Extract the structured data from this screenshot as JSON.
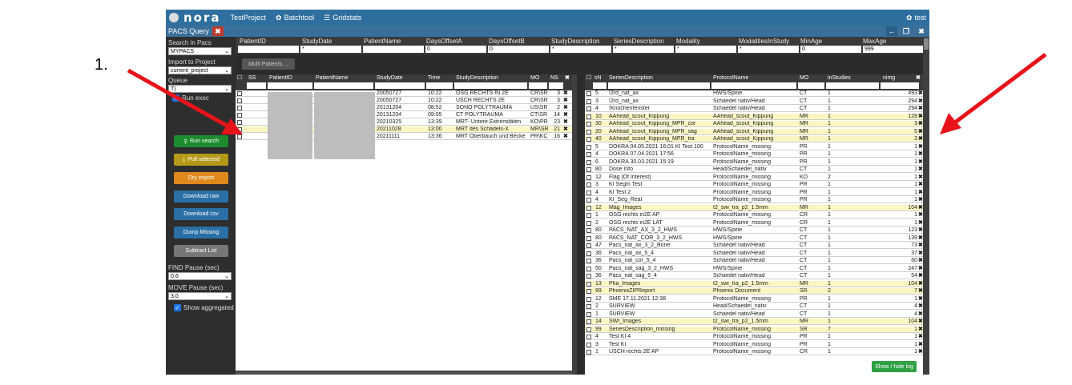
{
  "topbar": {
    "logo": "nora",
    "nav": [
      {
        "label": "TestProject",
        "icon": "none"
      },
      {
        "label": "Batchtool",
        "icon": "gear-icon"
      },
      {
        "label": "Gridstats",
        "icon": "list-icon"
      }
    ],
    "user": "test"
  },
  "tab": {
    "title": "PACS Query"
  },
  "sidebar": {
    "search_in_pacs": "Search in Pacs",
    "pacs_value": "MYPACS",
    "import_to_project": "Import to Project",
    "project_value": "current_project",
    "queue": "Queue",
    "queue_value": "T)",
    "run_exec": "Run exec",
    "buttons": {
      "run_search": "Run search",
      "pull_selected": "Pull selected",
      "dry_import": "Dry import",
      "download_raw": "Download raw",
      "download_csv": "Download csv",
      "dump_missing": "Dump Missing",
      "subtract_list": "Subtract List"
    },
    "find_pause": "FIND Pause (sec)",
    "find_pause_value": "0.6",
    "move_pause": "MOVE Pause (sec)",
    "move_pause_value": "3.0",
    "show_aggregated": "Show aggregated"
  },
  "filters": {
    "headers": [
      "PatientID",
      "StudyDate",
      "PatientName",
      "DaysOffsetA",
      "DaysOffsetB",
      "StudyDescription",
      "SeriesDescription",
      "Modality",
      "ModalitiesInStudy",
      "MinAge",
      "MaxAge"
    ],
    "values": [
      "",
      "*",
      "",
      "0",
      "0",
      "*",
      "*",
      "*",
      "*",
      "0",
      "999"
    ]
  },
  "multi_patients": "Multi Patients ...",
  "studies": {
    "headers": [
      "SS",
      "PatientID",
      "PatientName",
      "StudyDate",
      "Time",
      "StudyDescription",
      "MO",
      "NS"
    ],
    "rows": [
      {
        "date": "20050727",
        "time": "10:22",
        "desc": "OSG RECHTS IN 2E",
        "mo": "CR\\SR",
        "ns": "3",
        "hl": false
      },
      {
        "date": "20050727",
        "time": "10:22",
        "desc": "USCH RECHTS 2E",
        "mo": "CR\\SR",
        "ns": "3",
        "hl": false
      },
      {
        "date": "20131204",
        "time": "08:52",
        "desc": "SONO POLYTRAUMA",
        "mo": "US\\SR",
        "ns": "2",
        "hl": false
      },
      {
        "date": "20131204",
        "time": "09:05",
        "desc": "CT POLYTRAUMA",
        "mo": "CT\\SR",
        "ns": "14",
        "hl": false
      },
      {
        "date": "20210325",
        "time": "13:39",
        "desc": "MRT- Untere Extremitäten",
        "mo": "KO\\PR",
        "ns": "23",
        "hl": false
      },
      {
        "date": "20211028",
        "time": "13:00",
        "desc": "MRT des Schädels-X",
        "mo": "MR\\SR",
        "ns": "21",
        "hl": true
      },
      {
        "date": "20211111",
        "time": "13:36",
        "desc": "MRT Oberbauch und Becke",
        "mo": "PR\\KC",
        "ns": "16",
        "hl": false
      }
    ]
  },
  "series": {
    "headers": [
      "sN",
      "SeriesDescription",
      "ProtocolName",
      "MO",
      "inStudies",
      "nimg"
    ],
    "rows": [
      {
        "n": "5",
        "desc": "!2rd_nat_ax",
        "proto": "HWS/Spine",
        "mo": "CT",
        "in": "1",
        "nimg": "493",
        "hl": false
      },
      {
        "n": "3",
        "desc": "!2rd_nat_ax",
        "proto": "Schaedel nativ/Head",
        "mo": "CT",
        "in": "1",
        "nimg": "294",
        "hl": false
      },
      {
        "n": "4",
        "desc": "!Knochenfenster",
        "proto": "Schaedel nativ/Head",
        "mo": "CT",
        "in": "1",
        "nimg": "294",
        "hl": false
      },
      {
        "n": "10",
        "desc": "AAhead_scout_Kippung",
        "proto": "AAhead_scout_Kippung",
        "mo": "MR",
        "in": "1",
        "nimg": "128",
        "hl": true
      },
      {
        "n": "30",
        "desc": "AAhead_scout_Kippung_MPR_cor",
        "proto": "AAhead_scout_Kippung",
        "mo": "MR",
        "in": "1",
        "nimg": "3",
        "hl": true
      },
      {
        "n": "20",
        "desc": "AAhead_scout_Kippung_MPR_sag",
        "proto": "AAhead_scout_Kippung",
        "mo": "MR",
        "in": "1",
        "nimg": "5",
        "hl": true
      },
      {
        "n": "40",
        "desc": "AAhead_scout_Kippung_MPR_tra",
        "proto": "AAhead_scout_Kippung",
        "mo": "MR",
        "in": "1",
        "nimg": "3",
        "hl": true
      },
      {
        "n": "5",
        "desc": "DOKRA 04.05.2021 16:01 KI Test 100",
        "proto": "ProtocolName_missing",
        "mo": "PR",
        "in": "1",
        "nimg": "1",
        "hl": false
      },
      {
        "n": "4",
        "desc": "DOKRA 07.04.2021 17:56",
        "proto": "ProtocolName_missing",
        "mo": "PR",
        "in": "1",
        "nimg": "1",
        "hl": false
      },
      {
        "n": "6",
        "desc": "DOKRA 30.03.2021 15:19",
        "proto": "ProtocolName_missing",
        "mo": "PR",
        "in": "1",
        "nimg": "1",
        "hl": false
      },
      {
        "n": "80",
        "desc": "Dose Info",
        "proto": "Head/Schaedel_nativ",
        "mo": "CT",
        "in": "1",
        "nimg": "1",
        "hl": false
      },
      {
        "n": "12",
        "desc": "Flag [Of Interest]",
        "proto": "ProtocolName_missing",
        "mo": "KO",
        "in": "2",
        "nimg": "1",
        "hl": false
      },
      {
        "n": "3",
        "desc": "KI Segm Test",
        "proto": "ProtocolName_missing",
        "mo": "PR",
        "in": "1",
        "nimg": "1",
        "hl": false
      },
      {
        "n": "4",
        "desc": "KI Test 2",
        "proto": "ProtocolName_missing",
        "mo": "PR",
        "in": "1",
        "nimg": "1",
        "hl": false
      },
      {
        "n": "4",
        "desc": "KI_Seg_Real",
        "proto": "ProtocolName_missing",
        "mo": "PR",
        "in": "1",
        "nimg": "1",
        "hl": false
      },
      {
        "n": "12",
        "desc": "Mag_Images",
        "proto": "t2_swi_tra_p2_1.5mm",
        "mo": "MR",
        "in": "1",
        "nimg": "104",
        "hl": true
      },
      {
        "n": "1",
        "desc": "OSG rechts in2E AP",
        "proto": "ProtocolName_missing",
        "mo": "CR",
        "in": "1",
        "nimg": "1",
        "hl": false
      },
      {
        "n": "2",
        "desc": "OSG rechts in2E LAT",
        "proto": "ProtocolName_missing",
        "mo": "CR",
        "in": "1",
        "nimg": "1",
        "hl": false
      },
      {
        "n": "80",
        "desc": "PACS_NAT_AX_3_2_HWS",
        "proto": "HWS/Spine",
        "mo": "CT",
        "in": "1",
        "nimg": "123",
        "hl": false
      },
      {
        "n": "80",
        "desc": "PACS_NAT_COR_3_2_HWS",
        "proto": "HWS/Spine",
        "mo": "CT",
        "in": "1",
        "nimg": "139",
        "hl": false
      },
      {
        "n": "47",
        "desc": "Pacs_nat_ax_3_2_Bone",
        "proto": "Schaedel nativ/Head",
        "mo": "CT",
        "in": "1",
        "nimg": "73",
        "hl": false
      },
      {
        "n": "36",
        "desc": "Pacs_nat_ax_5_4",
        "proto": "Schaedel nativ/Head",
        "mo": "CT",
        "in": "1",
        "nimg": "37",
        "hl": false
      },
      {
        "n": "36",
        "desc": "Pacs_nat_cor_5_4",
        "proto": "Schaedel nativ/Head",
        "mo": "CT",
        "in": "1",
        "nimg": "60",
        "hl": false
      },
      {
        "n": "50",
        "desc": "Pacs_nat_sag_3_2_HWS",
        "proto": "HWS/Spine",
        "mo": "CT",
        "in": "1",
        "nimg": "247",
        "hl": false
      },
      {
        "n": "36",
        "desc": "Pacs_nat_sag_5_4",
        "proto": "Schaedel nativ/Head",
        "mo": "CT",
        "in": "1",
        "nimg": "54",
        "hl": false
      },
      {
        "n": "13",
        "desc": "Pha_Images",
        "proto": "t2_swi_tra_p2_1.5mm",
        "mo": "MR",
        "in": "1",
        "nimg": "104",
        "hl": true
      },
      {
        "n": "99",
        "desc": "PhoenixZIPReport",
        "proto": "Phoenix Document",
        "mo": "SR",
        "in": "2",
        "nimg": "7",
        "hl": true
      },
      {
        "n": "12",
        "desc": "SME 17.11.2021 12:38",
        "proto": "ProtocolName_missing",
        "mo": "PR",
        "in": "1",
        "nimg": "1",
        "hl": false
      },
      {
        "n": "2",
        "desc": "SURVIEW",
        "proto": "Head/Schaedel_nativ",
        "mo": "CT",
        "in": "1",
        "nimg": "4",
        "hl": false
      },
      {
        "n": "1",
        "desc": "SURVIEW",
        "proto": "Schaedel nativ/Head",
        "mo": "CT",
        "in": "1",
        "nimg": "4",
        "hl": false
      },
      {
        "n": "14",
        "desc": "SWI_Images",
        "proto": "t2_swi_tra_p2_1.5mm",
        "mo": "MR",
        "in": "1",
        "nimg": "104",
        "hl": true
      },
      {
        "n": "99",
        "desc": "SeriesDescription_missing",
        "proto": "ProtocolName_missing",
        "mo": "SR",
        "in": "7",
        "nimg": "1",
        "hl": true
      },
      {
        "n": "4",
        "desc": "Test KI 4",
        "proto": "ProtocolName_missing",
        "mo": "PR",
        "in": "1",
        "nimg": "1",
        "hl": false
      },
      {
        "n": "3",
        "desc": "Test KI",
        "proto": "ProtocolName_missing",
        "mo": "PR",
        "in": "1",
        "nimg": "1",
        "hl": false
      },
      {
        "n": "1",
        "desc": "USCH rechts 2E AP",
        "proto": "ProtocolName_missing",
        "mo": "CR",
        "in": "1",
        "nimg": "1",
        "hl": false
      }
    ]
  },
  "show_hide_log": "Show / hide log",
  "annotation": "1.",
  "colors": {
    "accent": "#2f6f9f",
    "highlight": "#fbf7c3",
    "arrow": "#e8141b",
    "green": "#2ea043"
  }
}
